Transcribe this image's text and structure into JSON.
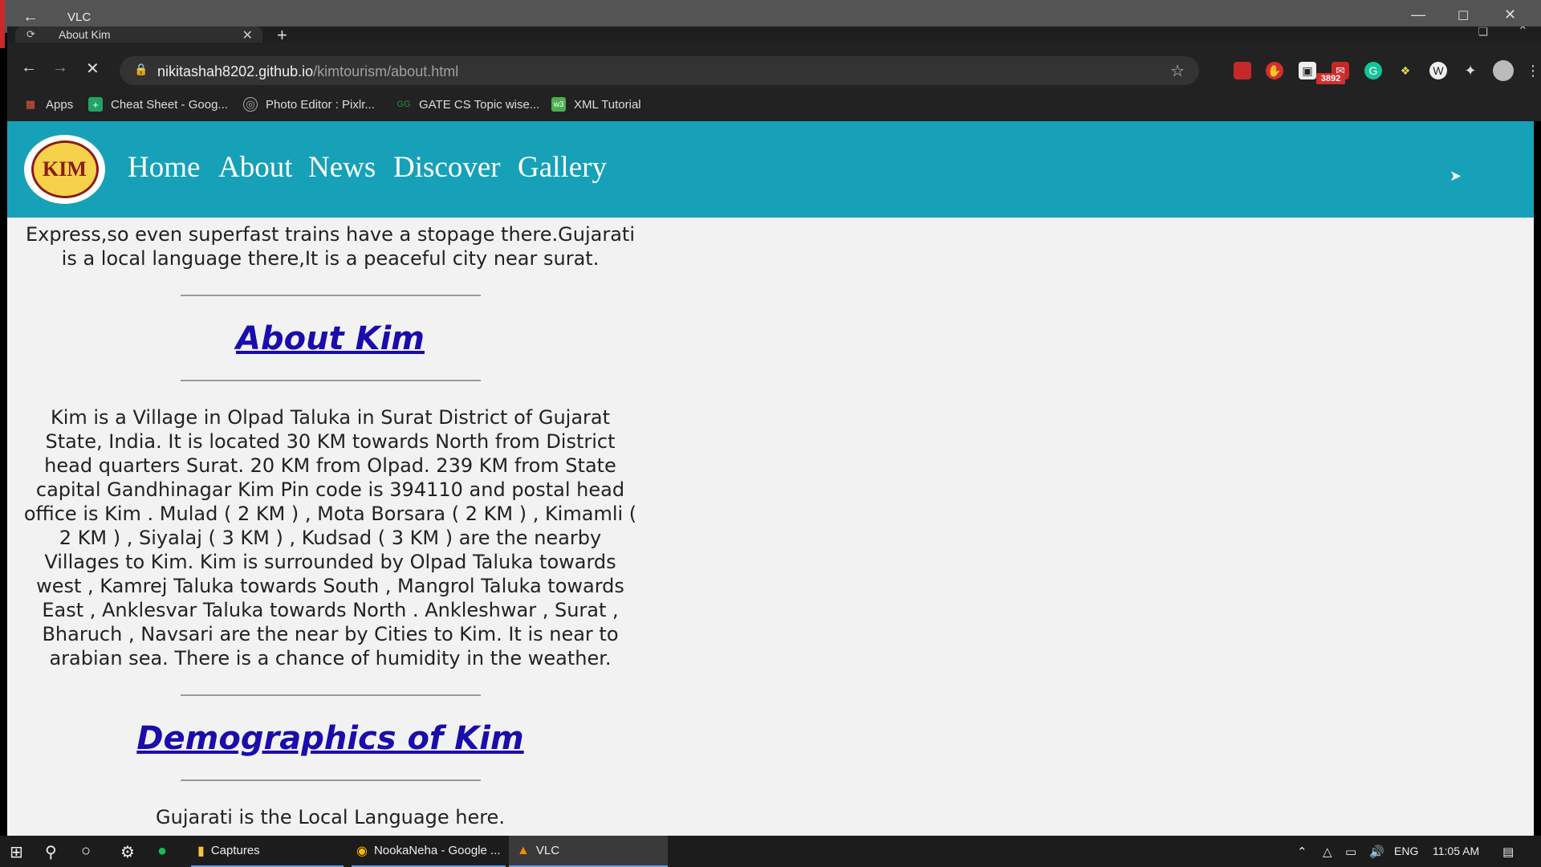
{
  "vlc": {
    "title": "VLC"
  },
  "browser": {
    "tab_label": "About Kim",
    "url_host": "nikitashah8202.github.io",
    "url_path": "/kimtourism/about.html",
    "extension_badge": "3892",
    "bookmarks": [
      {
        "label": "Apps",
        "icon": "apps-grid-icon"
      },
      {
        "label": "Cheat Sheet - Goog...",
        "icon": "sheets-icon"
      },
      {
        "label": "Photo Editor : Pixlr...",
        "icon": "pixlr-icon"
      },
      {
        "label": "GATE CS Topic wise...",
        "icon": "geeksforgeeks-icon"
      },
      {
        "label": "XML Tutorial",
        "icon": "w3schools-icon"
      }
    ]
  },
  "site": {
    "logo_text": "KIM",
    "nav": [
      "Home",
      "About",
      "News",
      "Discover",
      "Gallery"
    ],
    "intro_paragraph": "Express,so even superfast trains have a stopage there.Gujarati is a local language there,It is a peaceful city near surat.",
    "about_heading": "About Kim",
    "about_paragraph": "Kim is a Village in Olpad Taluka in Surat District of Gujarat State, India. It is located 30 KM towards North from District head quarters Surat. 20 KM from Olpad. 239 KM from State capital Gandhinagar Kim Pin code is 394110 and postal head office is Kim . Mulad ( 2 KM ) , Mota Borsara ( 2 KM ) , Kimamli ( 2 KM ) , Siyalaj ( 3 KM ) , Kudsad ( 3 KM ) are the nearby Villages to Kim. Kim is surrounded by Olpad Taluka towards west , Kamrej Taluka towards South , Mangrol Taluka towards East , Anklesvar Taluka towards North . Ankleshwar , Surat , Bharuch , Navsari are the near by Cities to Kim. It is near to arabian sea. There is a chance of humidity in the weather.",
    "demographics_heading": "Demographics of Kim",
    "demographics_paragraph": "Gujarati is the Local Language here."
  },
  "taskbar": {
    "apps": [
      "Captures",
      "NookaNeha - Google ...",
      "VLC"
    ],
    "language": "ENG",
    "time": "11:05 AM"
  },
  "colors": {
    "site_nav": "#17a1b8",
    "link": "#1a0dab"
  }
}
